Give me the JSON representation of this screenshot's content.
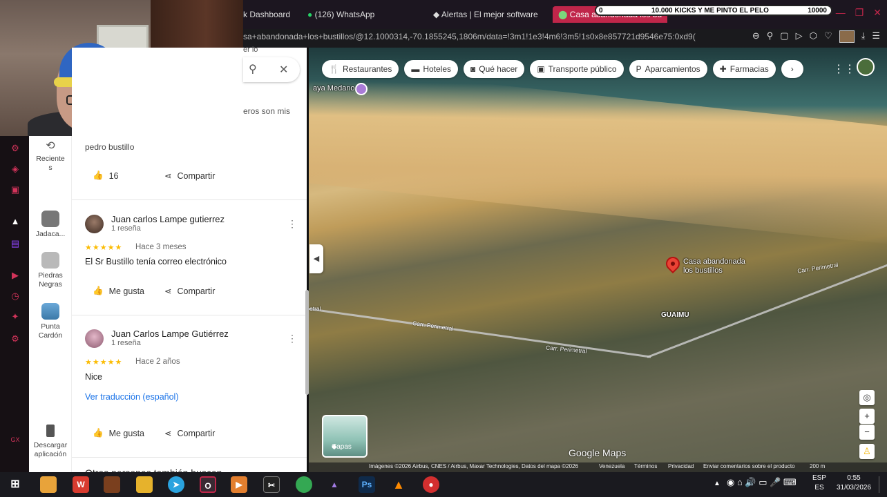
{
  "browser": {
    "tabs": [
      {
        "label": "k Dashboard"
      },
      {
        "label": "(126) WhatsApp"
      },
      {
        "label": "Alertas | El mejor software"
      },
      {
        "label": "Casa abandonada los bu"
      }
    ],
    "url": "sa+abandonada+los+bustillos/@12.1000314,-70.1855245,1806m/data=!3m1!1e3!4m6!3m5!1s0x8e857721d9546e75:0xd9(",
    "overlay": {
      "start": "0",
      "text": "10.000 KICKS Y ME PINTO EL PELO",
      "goal": "10000"
    }
  },
  "panel": {
    "partial_text_top": "er lo",
    "partial_text_mid": "eros son mis",
    "prev_review": {
      "author": "pedro bustillo",
      "likes": "16",
      "share": "Compartir"
    },
    "reviews": [
      {
        "author": "Juan carlos Lampe gutierrez",
        "count": "1 reseña",
        "stars": "★★★★★",
        "when": "Hace 3 meses",
        "text": "El Sr Bustillo tenía correo electrónico",
        "like": "Me gusta",
        "share": "Compartir"
      },
      {
        "author": "Juan Carlos Lampe Gutiérrez",
        "count": "1 reseña",
        "stars": "★★★★★",
        "when": "Hace 2 años",
        "text": "Nice",
        "translate": "Ver traducción (español)",
        "like": "Me gusta",
        "share": "Compartir"
      }
    ],
    "footer_partial": "Otras personas también buscan"
  },
  "rail": [
    {
      "label": "Reciente\ns"
    },
    {
      "label": "Jadaca..."
    },
    {
      "label": "Piedras\nNegras"
    },
    {
      "label": "Punta\nCardón"
    },
    {
      "label": "Descargar\naplicación"
    }
  ],
  "map": {
    "chips": [
      "Restaurantes",
      "Hoteles",
      "Qué hacer",
      "Transporte público",
      "Aparcamientos",
      "Farmacias"
    ],
    "place_label": "Casa abandonada\nlos bustillos",
    "area_label": "GUAIMU",
    "beach_label": "aya Medano",
    "road_labels": [
      "Carr. Perimetral",
      "Carr. Perimetral",
      "Carr. Perimetral",
      "etral"
    ],
    "layers_label": "Capas",
    "logo": "Google Maps",
    "attribution": "Imágenes ©2026 Airbus, CNES / Airbus, Maxar Technologies, Datos del mapa ©2026",
    "footer_links": [
      "Venezuela",
      "Términos",
      "Privacidad",
      "Enviar comentarios sobre el producto"
    ],
    "scale": "200 m"
  },
  "taskbar": {
    "lang": "ESP",
    "lang_sub": "ES",
    "time": "0:55",
    "date": "31/03/2026"
  },
  "colors": {
    "accent": "#c0264a",
    "star": "#fbbc04",
    "link": "#1a73e8"
  }
}
